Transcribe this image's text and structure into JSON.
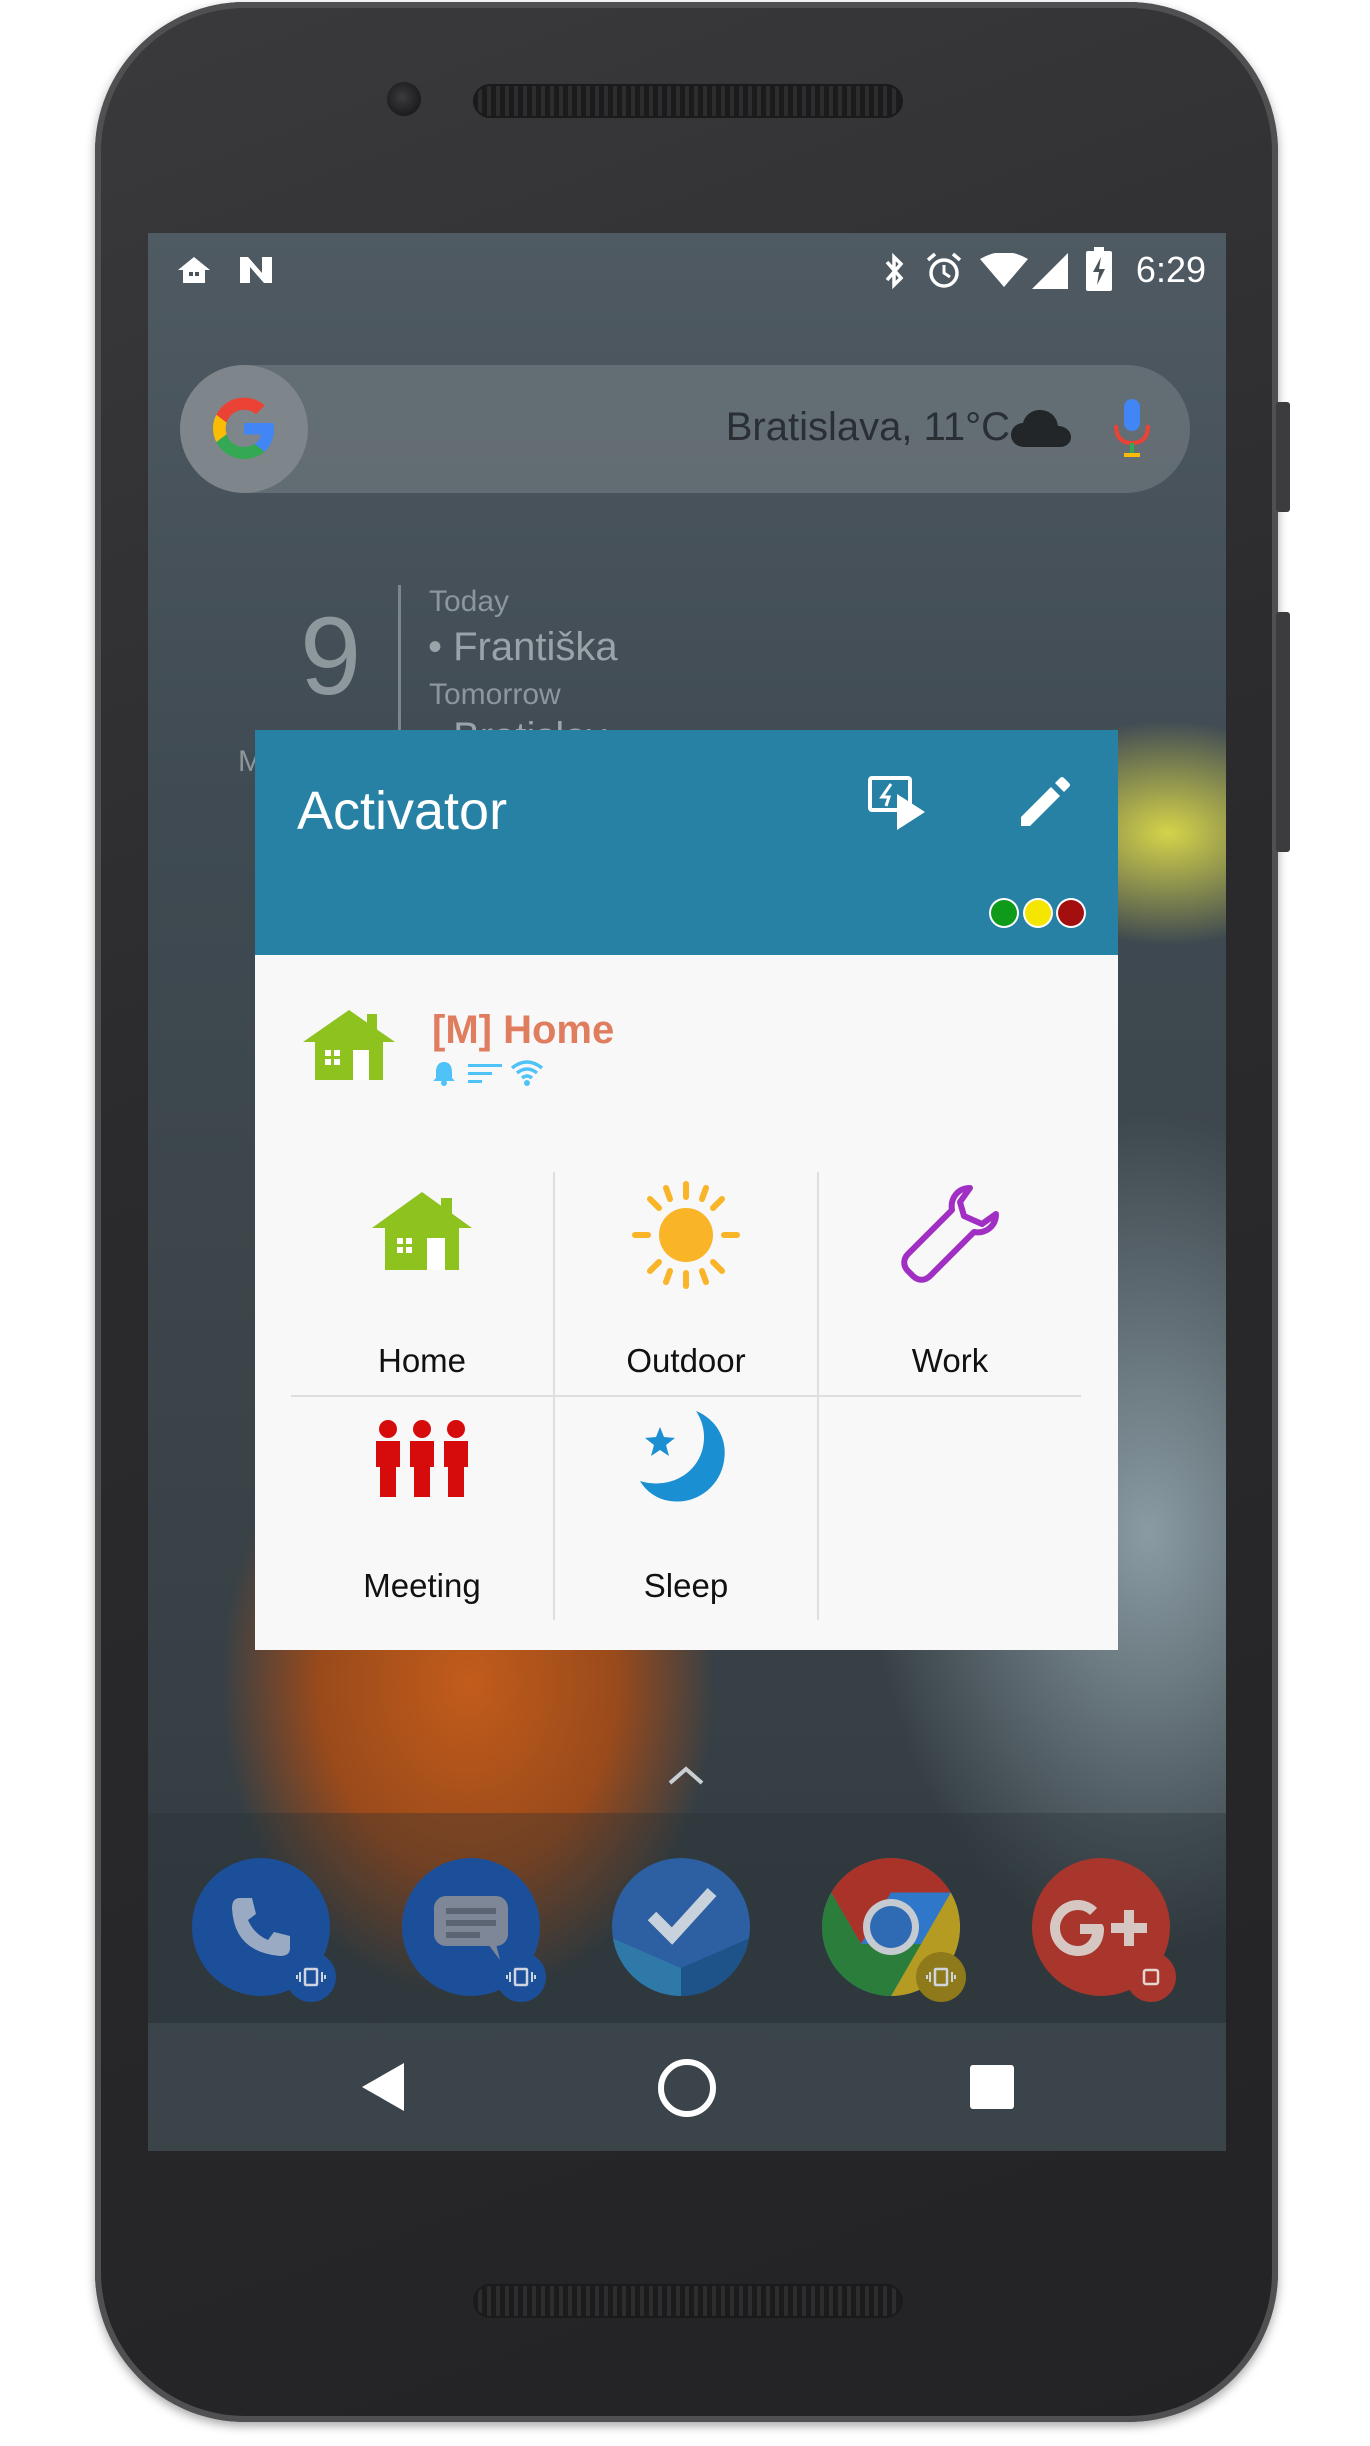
{
  "status_bar": {
    "time": "6:29",
    "left_icons": [
      "home-icon",
      "n-notification-icon"
    ],
    "right_icons": [
      "bluetooth-icon",
      "alarm-icon",
      "wifi-icon",
      "signal-icon",
      "battery-charging-icon"
    ]
  },
  "search_widget": {
    "weather_text": "Bratislava, 11°C",
    "icons": [
      "google-g-icon",
      "cloud-icon",
      "mic-icon"
    ]
  },
  "calendar_widget": {
    "day": "9",
    "month_partial": "M",
    "today_label": "Today",
    "today_event": "• Františka",
    "tomorrow_label": "Tomorrow",
    "tomorrow_event": "• Bratislav"
  },
  "activator_widget": {
    "title": "Activator",
    "header_color": "#2681a5",
    "actions": [
      "quick-run-icon",
      "edit-pencil-icon"
    ],
    "status_dots": [
      "#0f9a1a",
      "#f5e600",
      "#a30f0f"
    ],
    "current_profile": {
      "name": "[M] Home",
      "name_color": "#df7d5e",
      "indicator_icons": [
        "bell-icon",
        "list-lines-icon",
        "wifi-icon"
      ]
    },
    "profiles": [
      {
        "label": "Home",
        "icon": "house-icon",
        "color": "#8dc21f"
      },
      {
        "label": "Outdoor",
        "icon": "sun-icon",
        "color": "#f9b428"
      },
      {
        "label": "Work",
        "icon": "wrench-icon",
        "color": "#a12fc4"
      },
      {
        "label": "Meeting",
        "icon": "people-icon",
        "color": "#d60c0c"
      },
      {
        "label": "Sleep",
        "icon": "moon-star-icon",
        "color": "#1a8fd1"
      }
    ]
  },
  "dock": {
    "apps": [
      "phone-app-icon",
      "messages-app-icon",
      "inbox-app-icon",
      "chrome-app-icon",
      "google-plus-app-icon"
    ],
    "app_drawer_icon": "chevron-up-icon"
  },
  "nav_bar": {
    "buttons": [
      "back-icon",
      "home-button-icon",
      "recents-icon"
    ]
  }
}
